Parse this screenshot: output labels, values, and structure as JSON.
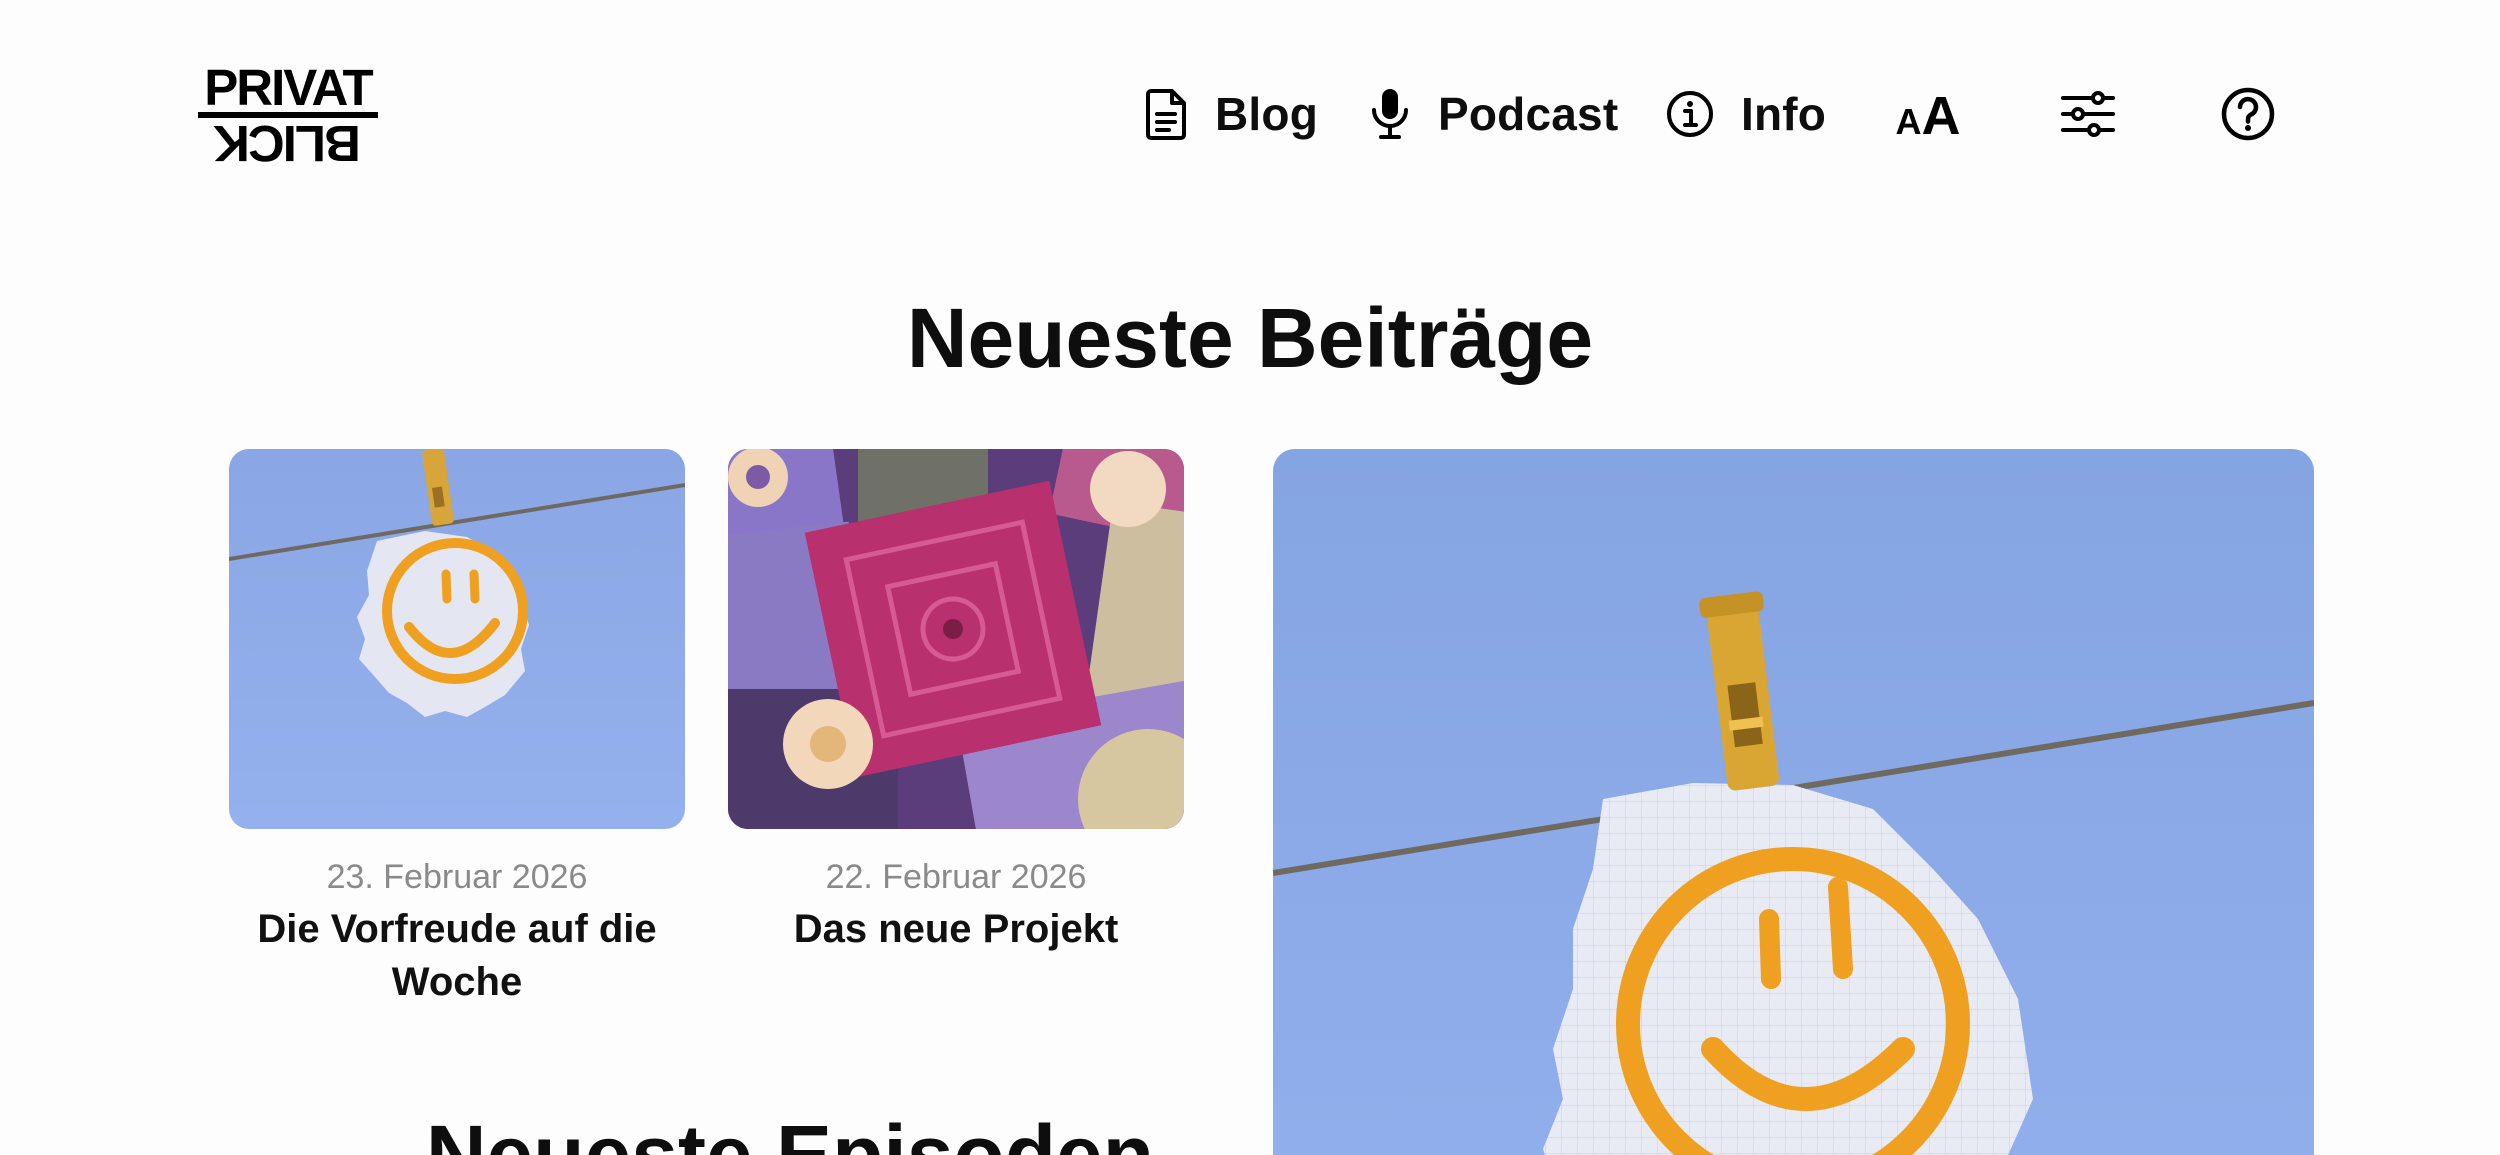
{
  "logo": {
    "line1": "PRIVAT",
    "line2": "BLICK"
  },
  "nav": {
    "blog": {
      "label": "Blog",
      "icon": "document-icon"
    },
    "podcast": {
      "label": "Podcast",
      "icon": "microphone-icon"
    },
    "info": {
      "label": "Info",
      "icon": "info-circle-icon"
    }
  },
  "tools": {
    "font_size": {
      "small": "A",
      "big": "A",
      "icon": "font-size-icon"
    },
    "settings": {
      "icon": "sliders-icon"
    },
    "help": {
      "icon": "question-circle-icon"
    }
  },
  "sections": {
    "posts_heading": "Neueste Beiträge",
    "episodes_heading": "Neueste Episoden"
  },
  "posts": [
    {
      "date": "23. Februar 2026",
      "title": "Die Vorfreude auf die Woche",
      "image": "smiley-note-on-clothesline"
    },
    {
      "date": "22. Februar 2026",
      "title": "Das neue Projekt",
      "image": "crochet-granny-squares"
    }
  ],
  "featured": {
    "image": "smiley-note-on-clothesline"
  },
  "colors": {
    "sky": "#8aa8e6",
    "smiley": "#f0a020",
    "crochet_pink": "#b8306e",
    "crochet_purple": "#8a76c8",
    "text": "#0e0e0e",
    "date": "#8a8a8a"
  }
}
